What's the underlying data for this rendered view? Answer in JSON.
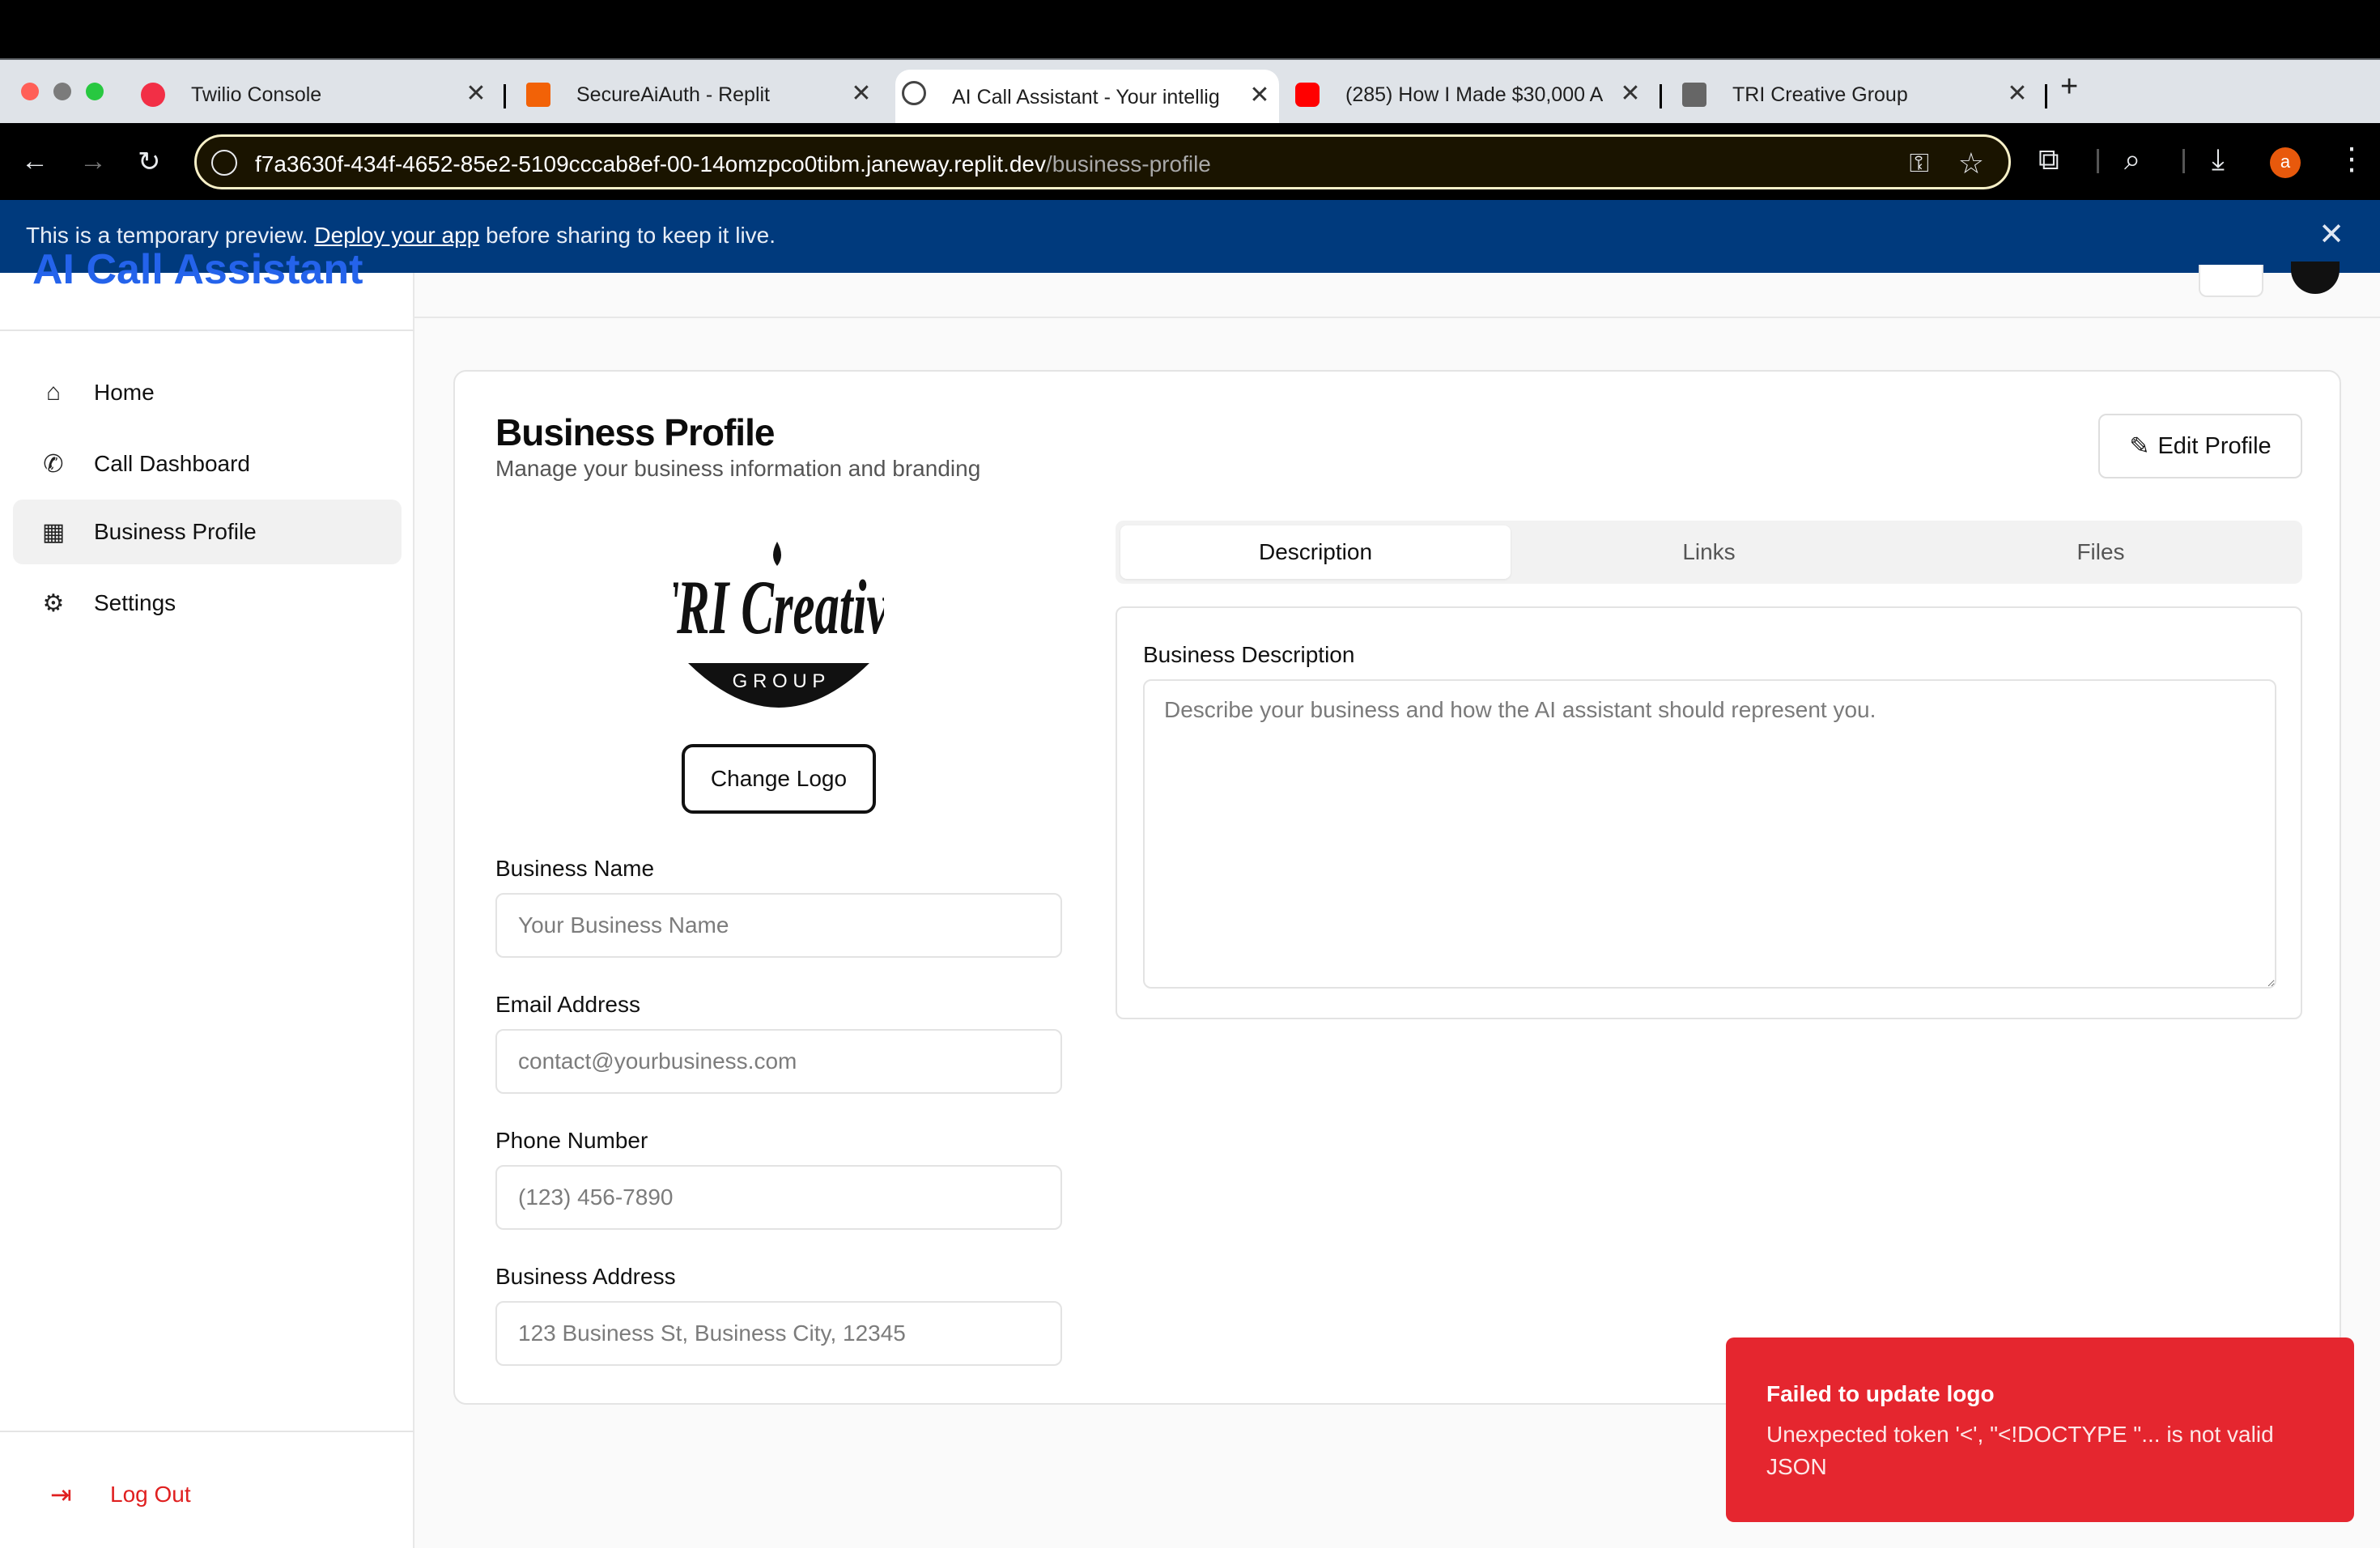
{
  "browser": {
    "tabs": [
      {
        "title": "Twilio Console",
        "close": "✕",
        "icon_color": "#f22f46"
      },
      {
        "title": "SecureAiAuth - Replit",
        "close": "✕",
        "icon_color": "#f26207"
      },
      {
        "title": "AI Call Assistant - Your intellig",
        "close": "✕",
        "icon_color": "#444444"
      },
      {
        "title": "(285) How I Made $30,000 A",
        "close": "✕",
        "icon_color": "#ff0000"
      },
      {
        "title": "TRI Creative Group",
        "close": "✕",
        "icon_color": "#555555"
      }
    ],
    "new_tab": "+",
    "url_host": "f7a3630f-434f-4652-85e2-5109cccab8ef-00-14omzpco0tibm.janeway.replit.dev",
    "url_path": "/business-profile",
    "profile_initial": "a"
  },
  "banner": {
    "prefix": "This is a temporary preview. ",
    "link": "Deploy your app",
    "suffix": " before sharing to keep it live.",
    "close": "✕"
  },
  "sidebar": {
    "brand": "AI Call Assistant",
    "items": [
      {
        "label": "Home",
        "icon": "home-icon"
      },
      {
        "label": "Call Dashboard",
        "icon": "phone-icon"
      },
      {
        "label": "Business Profile",
        "icon": "building-icon"
      },
      {
        "label": "Settings",
        "icon": "gear-icon"
      }
    ],
    "logout": "Log Out"
  },
  "profile": {
    "title": "Business Profile",
    "subtitle": "Manage your business information and branding",
    "edit_button": "Edit Profile",
    "logo_text": "TRI Creative",
    "logo_subtext": "G R O U P",
    "change_logo": "Change Logo",
    "fields": {
      "name_label": "Business Name",
      "name_placeholder": "Your Business Name",
      "email_label": "Email Address",
      "email_placeholder": "contact@yourbusiness.com",
      "phone_label": "Phone Number",
      "phone_placeholder": "(123) 456-7890",
      "address_label": "Business Address",
      "address_placeholder": "123 Business St, Business City, 12345"
    },
    "tabs": [
      "Description",
      "Links",
      "Files"
    ],
    "active_tab": "Description",
    "description_label": "Business Description",
    "description_placeholder": "Describe your business and how the AI assistant should represent you."
  },
  "toast": {
    "title": "Failed to update logo",
    "body": "Unexpected token '<', \"<!DOCTYPE \"... is not valid JSON"
  }
}
